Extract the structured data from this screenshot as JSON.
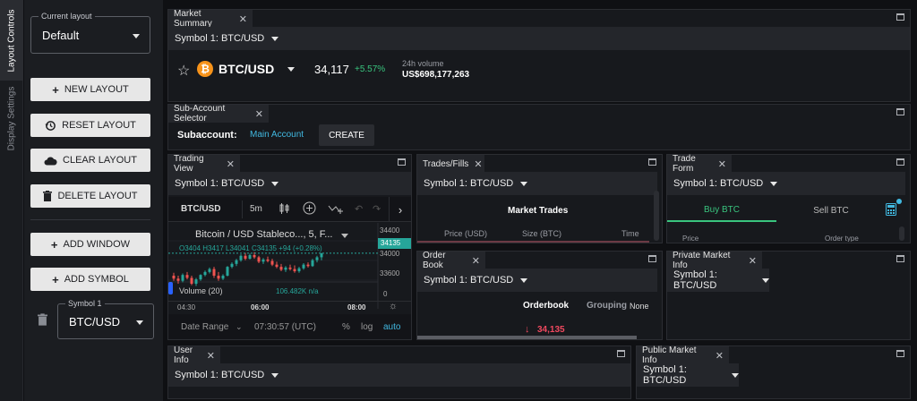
{
  "sidebar_tabs": [
    "Layout Controls",
    "Display Settings"
  ],
  "controls": {
    "layout_label": "Current layout",
    "layout_value": "Default",
    "buttons": {
      "new_layout": "NEW LAYOUT",
      "reset_layout": "RESET LAYOUT",
      "clear_layout": "CLEAR LAYOUT",
      "delete_layout": "DELETE LAYOUT",
      "add_window": "ADD WINDOW",
      "add_symbol": "ADD SYMBOL"
    },
    "symbol_label": "Symbol 1",
    "symbol_value": "BTC/USD"
  },
  "market_summary": {
    "tab": "Market Summary",
    "symbol_select": "Symbol 1: BTC/USD",
    "pair": "BTC/USD",
    "price": "34,117",
    "change": "+5.57%",
    "volume_label": "24h volume",
    "volume_value": "US$698,177,263"
  },
  "subaccount": {
    "tab": "Sub-Account Selector",
    "label": "Subaccount:",
    "main": "Main Account",
    "create": "CREATE"
  },
  "trading_view": {
    "tab": "Trading View",
    "symbol_select": "Symbol 1: BTC/USD",
    "pair": "BTC/USD",
    "interval": "5m",
    "legend_title": "Bitcoin / USD Stableco..., 5, F...",
    "ohlc": "O3404  H3417  L34041  C34135  +94 (+0.28%)",
    "volume_label": "Volume (20)",
    "volume_value": "106.482K  n/a",
    "price_ticks": [
      "34400",
      "34135",
      "34000",
      "33600",
      "0"
    ],
    "time_ticks": [
      "04:30",
      "06:00",
      "08:00"
    ],
    "date_range": "Date Range",
    "clock": "07:30:57 (UTC)",
    "pct": "%",
    "log": "log",
    "auto": "auto",
    "colors": {
      "up": "#26a69a",
      "down": "#ef5350"
    }
  },
  "trades": {
    "tab": "Trades/Fills",
    "symbol_select": "Symbol 1: BTC/USD",
    "title": "Market Trades",
    "cols": [
      "Price (USD)",
      "Size (BTC)",
      "Time"
    ]
  },
  "trade_form": {
    "tab": "Trade Form",
    "symbol_select": "Symbol 1: BTC/USD",
    "buy": "Buy BTC",
    "sell": "Sell BTC",
    "cols": [
      "Price",
      "Order type"
    ]
  },
  "order_book": {
    "tab": "Order Book",
    "symbol_select": "Symbol 1: BTC/USD",
    "title": "Orderbook",
    "grouping_label": "Grouping",
    "grouping_value": "None",
    "last_price": "34,135"
  },
  "private_market": {
    "tab": "Private Market Info",
    "symbol_select": "Symbol 1: BTC/USD"
  },
  "user_info": {
    "tab": "User Info",
    "symbol_select": "Symbol 1: BTC/USD"
  },
  "public_market": {
    "tab": "Public Market Info",
    "symbol_select": "Symbol 1: BTC/USD"
  },
  "candles": [
    {
      "o": 33830,
      "h": 33870,
      "l": 33760,
      "c": 33790
    },
    {
      "o": 33790,
      "h": 33830,
      "l": 33720,
      "c": 33760
    },
    {
      "o": 33760,
      "h": 33860,
      "l": 33740,
      "c": 33840
    },
    {
      "o": 33840,
      "h": 33880,
      "l": 33780,
      "c": 33800
    },
    {
      "o": 33800,
      "h": 33830,
      "l": 33700,
      "c": 33720
    },
    {
      "o": 33720,
      "h": 33800,
      "l": 33690,
      "c": 33780
    },
    {
      "o": 33780,
      "h": 33850,
      "l": 33760,
      "c": 33840
    },
    {
      "o": 33840,
      "h": 33900,
      "l": 33820,
      "c": 33880
    },
    {
      "o": 33880,
      "h": 33940,
      "l": 33860,
      "c": 33920
    },
    {
      "o": 33920,
      "h": 33950,
      "l": 33800,
      "c": 33830
    },
    {
      "o": 33830,
      "h": 33880,
      "l": 33760,
      "c": 33790
    },
    {
      "o": 33790,
      "h": 33850,
      "l": 33770,
      "c": 33830
    },
    {
      "o": 33830,
      "h": 33960,
      "l": 33820,
      "c": 33950
    },
    {
      "o": 33950,
      "h": 34010,
      "l": 33930,
      "c": 33990
    },
    {
      "o": 33990,
      "h": 34060,
      "l": 33960,
      "c": 34040
    },
    {
      "o": 34040,
      "h": 34120,
      "l": 34020,
      "c": 34100
    },
    {
      "o": 34100,
      "h": 34140,
      "l": 34040,
      "c": 34060
    },
    {
      "o": 34060,
      "h": 34130,
      "l": 34050,
      "c": 34110
    },
    {
      "o": 34110,
      "h": 34150,
      "l": 34060,
      "c": 34080
    },
    {
      "o": 34080,
      "h": 34100,
      "l": 34000,
      "c": 34020
    },
    {
      "o": 34020,
      "h": 34070,
      "l": 33990,
      "c": 34050
    },
    {
      "o": 34050,
      "h": 34090,
      "l": 34010,
      "c": 34030
    },
    {
      "o": 34030,
      "h": 34060,
      "l": 33960,
      "c": 33980
    },
    {
      "o": 33980,
      "h": 34020,
      "l": 33930,
      "c": 33950
    },
    {
      "o": 33950,
      "h": 33990,
      "l": 33890,
      "c": 33910
    },
    {
      "o": 33910,
      "h": 33960,
      "l": 33880,
      "c": 33940
    },
    {
      "o": 33940,
      "h": 33980,
      "l": 33900,
      "c": 33920
    },
    {
      "o": 33920,
      "h": 33970,
      "l": 33870,
      "c": 33890
    },
    {
      "o": 33890,
      "h": 33950,
      "l": 33870,
      "c": 33930
    },
    {
      "o": 33930,
      "h": 34000,
      "l": 33910,
      "c": 33980
    },
    {
      "o": 33980,
      "h": 34010,
      "l": 33940,
      "c": 33960
    },
    {
      "o": 33960,
      "h": 34060,
      "l": 33950,
      "c": 34040
    },
    {
      "o": 34040,
      "h": 34100,
      "l": 34010,
      "c": 34080
    },
    {
      "o": 34080,
      "h": 34140,
      "l": 34040,
      "c": 34135
    }
  ]
}
